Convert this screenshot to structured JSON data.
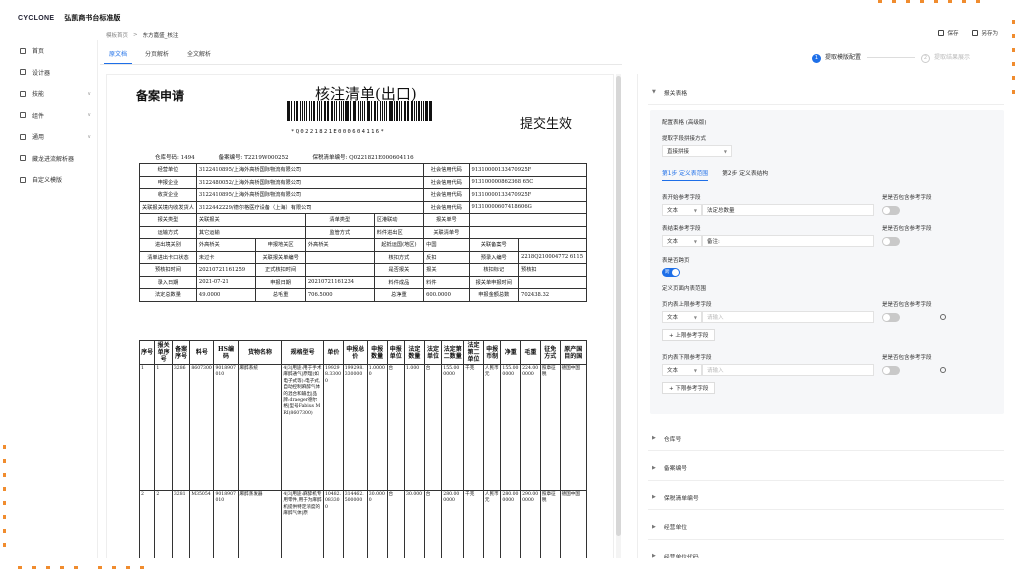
{
  "app": {
    "logo": "CYCLONE",
    "name": "弘凯商书台标准版"
  },
  "sidebar": {
    "items": [
      {
        "label": "首页",
        "icon": "home-icon",
        "chevron": false
      },
      {
        "label": "设计器",
        "icon": "design-icon",
        "chevron": false
      },
      {
        "label": "技能",
        "icon": "skill-icon",
        "chevron": true
      },
      {
        "label": "组件",
        "icon": "component-icon",
        "chevron": true
      },
      {
        "label": "通用",
        "icon": "general-icon",
        "chevron": true
      },
      {
        "label": "藏龙进流解析器",
        "icon": "parser-icon",
        "chevron": false
      },
      {
        "label": "自定义模版",
        "icon": "template-icon",
        "chevron": false
      }
    ]
  },
  "breadcrumb": {
    "parent": "模板首页",
    "separator": ">",
    "current": "东方嘉盛_核注"
  },
  "tabs": [
    "原文档",
    "分页解析",
    "全文解析"
  ],
  "toolbar": {
    "save": "保存",
    "save_as": "另存为"
  },
  "steps": [
    {
      "num": "1",
      "label": "提取模版配置"
    },
    {
      "num": "2",
      "label": "提取结果展示"
    }
  ],
  "doc": {
    "title_left": "备案申请",
    "title_center": "核注清单(出口)",
    "title_right": "提交生效",
    "barcode_number": "*Q0221821E000604116*",
    "meta": [
      "仓库号码:",
      "1494",
      "备案编号:",
      "T2219W000252",
      "保税清单编号:",
      "Q0221821E000604116"
    ],
    "rows": [
      [
        "经营单位",
        "3122410895/上海外高桥国际物流有限公司",
        "社会信用代码",
        "91310000133470925F"
      ],
      [
        "申报企业",
        "3122480052/上海外高桥国际物流有限公司",
        "社会信用代码",
        "913100000862368 65C"
      ],
      [
        "收货企业",
        "3122410895/上海外高桥国际物流有限公司",
        "社会信用代码",
        "91310000133470925F"
      ],
      [
        "关联报关境内收发货人",
        "3122442229/德尔格医疗设备（上海）有限公司",
        "社会信用代码",
        "91310000607418606G"
      ]
    ],
    "rows4": [
      [
        "报关类型",
        "关联报关",
        "清单类型",
        "区港联动",
        "报关单号",
        ""
      ],
      [
        "运输方式",
        "其它运输",
        "监管方式",
        "料件进出区",
        "关联清单号",
        ""
      ],
      [
        "进出境关别",
        "外高桥关",
        "申报地关区",
        "外高桥关",
        "起抵运国(地区)",
        "中国",
        "关联备案号",
        ""
      ],
      [
        "清单进出卡口状态",
        "未过卡",
        "关联报关单编号",
        "",
        "核扣方式",
        "反扣",
        "预录入编号",
        "2218Q210004772 6115"
      ],
      [
        "预核扣时间",
        "20210721161259",
        "正式核扣时间",
        "",
        "是否报关",
        "报关",
        "核扣标记",
        "预核扣"
      ],
      [
        "录入日期",
        "2021-07-21",
        "申报日期",
        "20210721161234",
        "料件成品",
        "料件",
        "报关单申报时间",
        ""
      ],
      [
        "法定总数量",
        "49.0000",
        "总毛重",
        "706.5000",
        "总净重",
        "600.0000",
        "申报金额总数",
        "702438.32"
      ]
    ],
    "goods_headers": [
      "序号",
      "报关单序号",
      "备案序号",
      "料号",
      "HS编码",
      "货物名称",
      "规格型号",
      "单价",
      "申报总价",
      "申报数量",
      "申报单位",
      "法定数量",
      "法定单位",
      "法定第二数量",
      "法定第二单位",
      "申报币制",
      "净重",
      "毛重",
      "征免方式",
      "原产国目的国"
    ],
    "goods": [
      [
        "1",
        "1",
        "3286",
        "8607300",
        "9018907010",
        "麻醉系统",
        "4|3|用途:用于手术麻醉通气|原理(如电子式等):电子式,自动控制麻醉气体的混合和输出|品牌:draeger德尔格|型号Fabius MRI(8607300)",
        "199298.33000",
        "199298.330000",
        "1.00000",
        "台",
        "1.000",
        "台",
        "155.000000",
        "千克",
        "人民币元",
        "155.000000",
        "224.000000",
        "照章征税",
        "德国中国"
      ],
      [
        "2",
        "2",
        "3281",
        "M35054",
        "9018907010",
        "麻醉蒸发器",
        "4|3|用途:麻醉机专用零件,用于为麻醉机提供特定浓度的麻醉气体|原",
        "10482.083300",
        "314462.500000",
        "30.0000",
        "台",
        "30.000",
        "台",
        "280.000000",
        "千克",
        "人民币元",
        "280.000000",
        "290.000000",
        "照章征税",
        "德国中国"
      ]
    ]
  },
  "panel": {
    "accordions_top": "报关表格",
    "config_title": "配置表格 (高级版)",
    "concat_label": "提取字段拼接方式",
    "concat_value": "直接拼接",
    "subtabs": [
      "第1步 定义表范围",
      "第2步 定义表结构"
    ],
    "start_label": "表开始参考字段",
    "start_type": "文本",
    "start_value": "法定总数量",
    "include_label": "是是否包含参考字段",
    "end_label": "表结束参考字段",
    "end_type": "文本",
    "end_value": "备注:",
    "cross_page_label": "表是否跨页",
    "cross_page_value": "跨",
    "page_range_label": "定义页面内表范围",
    "page_top_label": "页内表上限参考字段",
    "page_top_type": "文本",
    "page_top_ph": "请输入",
    "add_top": "+ 上限参考字段",
    "page_bottom_label": "页内表下限参考字段",
    "page_bottom_type": "文本",
    "page_bottom_ph": "请输入",
    "add_bottom": "+ 下限参考字段",
    "accordions": [
      "仓库号",
      "备案编号",
      "保税清单编号",
      "经营单位",
      "经营单位代码"
    ]
  }
}
